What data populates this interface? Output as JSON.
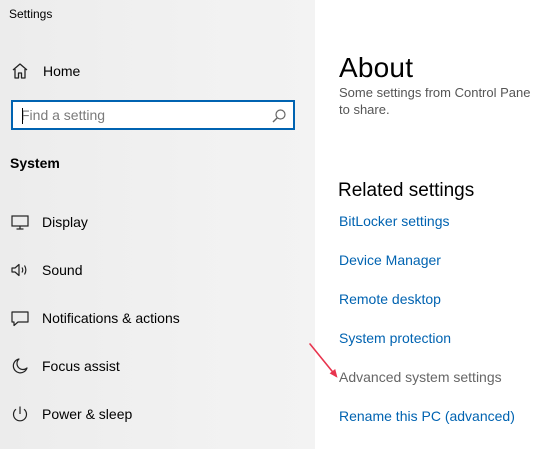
{
  "window": {
    "title": "Settings"
  },
  "sidebar": {
    "home_label": "Home",
    "search": {
      "placeholder": "Find a setting",
      "value": ""
    },
    "section_title": "System",
    "items": [
      {
        "label": "Display",
        "icon": "monitor-icon"
      },
      {
        "label": "Sound",
        "icon": "speaker-icon"
      },
      {
        "label": "Notifications & actions",
        "icon": "notification-icon"
      },
      {
        "label": "Focus assist",
        "icon": "moon-icon"
      },
      {
        "label": "Power & sleep",
        "icon": "power-icon"
      }
    ]
  },
  "main": {
    "title": "About",
    "description_line1": "Some settings from Control Pane",
    "description_line2": "to share.",
    "related_heading": "Related settings",
    "links": [
      "BitLocker settings",
      "Device Manager",
      "Remote desktop",
      "System protection",
      "Advanced system settings",
      "Rename this PC (advanced)"
    ]
  },
  "colors": {
    "accent": "#0063b1",
    "annotation_arrow": "#e8344e"
  }
}
